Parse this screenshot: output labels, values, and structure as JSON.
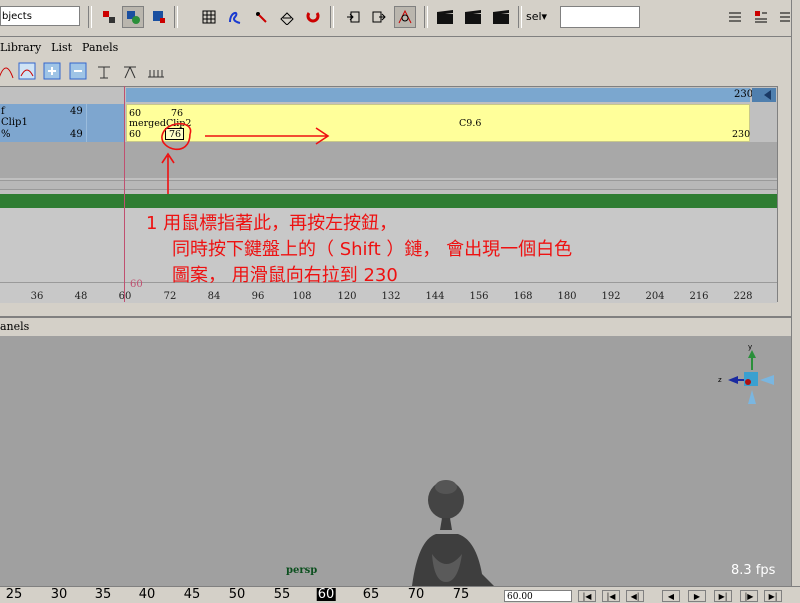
{
  "top_toolbar": {
    "objects_field": "bjects",
    "sel_dropdown": "sel▾",
    "icons": [
      "select-by-hierarchy-icon",
      "select-by-object-icon",
      "select-by-component-icon",
      "snap-grid-icon",
      "snap-curve-icon",
      "snap-point-icon",
      "snap-plane-icon",
      "snap-magnet-icon",
      "input-ops-icon",
      "output-ops-icon",
      "construction-history-icon",
      "render-icon",
      "ipr-render-icon",
      "render-settings-icon"
    ]
  },
  "trax": {
    "menu": [
      "Library",
      "List",
      "Panels"
    ],
    "summary_end": "230",
    "track": {
      "row1_label": "f",
      "row1_value": "49",
      "row2_label": "Clip1",
      "row3_label": "%",
      "row3_value": "49"
    },
    "clip": {
      "start_top": "60",
      "handle_top": "76",
      "name": "mergedClip2",
      "center_label": "C9.6",
      "start_bottom": "60",
      "handle_bottom": "76",
      "end_label": "230"
    },
    "time_marker": "60",
    "ruler": [
      "36",
      "48",
      "60",
      "72",
      "84",
      "96",
      "108",
      "120",
      "132",
      "144",
      "156",
      "168",
      "180",
      "192",
      "204",
      "216",
      "228"
    ]
  },
  "annotation": {
    "line1": "1 用鼠標指著此，再按左按鈕，",
    "line2": "同時按下鍵盤上的（ Shift ）鏈， 會出現一個白色",
    "line3": "圖案， 用滑鼠向右拉到 230"
  },
  "viewport": {
    "panels_label": "anels",
    "camera": "persp",
    "fps": "8.3 fps"
  },
  "time_slider": {
    "labels": [
      "25",
      "30",
      "35",
      "40",
      "45",
      "50",
      "55",
      "60",
      "65",
      "70",
      "75"
    ],
    "current_field": "60.00"
  }
}
